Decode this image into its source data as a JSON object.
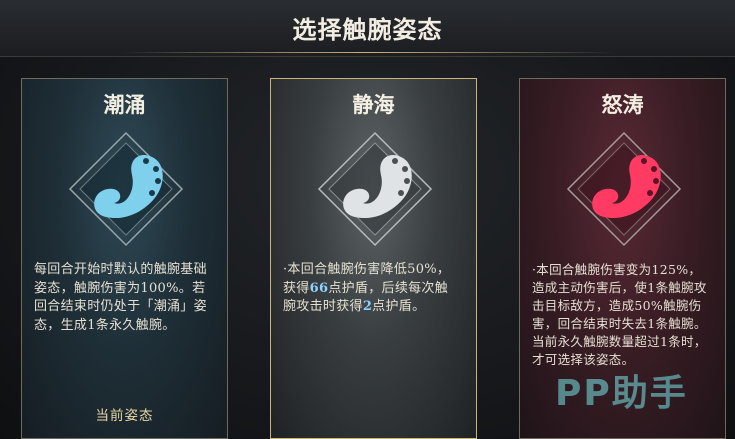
{
  "header": {
    "title": "选择触腕姿态"
  },
  "cards": [
    {
      "name": "潮涌",
      "description": "每回合开始时默认的触腕基础姿态，触腕伤害为100%。若回合结束时仍处于「潮涌」姿态，生成1条永久触腕。",
      "status": "当前姿态",
      "color": "#7fd0ec",
      "icon": "tentacle-icon"
    },
    {
      "name": "静海",
      "description_parts": [
        "·本回合触腕伤害降低50%，获得",
        "66",
        "点护盾，后续每次触腕攻击时获得",
        "2",
        "点护盾。"
      ],
      "color": "#dfe3e6",
      "icon": "tentacle-icon"
    },
    {
      "name": "怒涛",
      "description": "·本回合触腕伤害变为125%，造成主动伤害后，使1条触腕攻击目标敌方，造成50%触腕伤害，回合结束时失去1条触腕。当前永久触腕数量超过1条时，才可选择该姿态。",
      "color": "#ff3b64",
      "icon": "tentacle-icon"
    }
  ],
  "watermark": "PP助手"
}
